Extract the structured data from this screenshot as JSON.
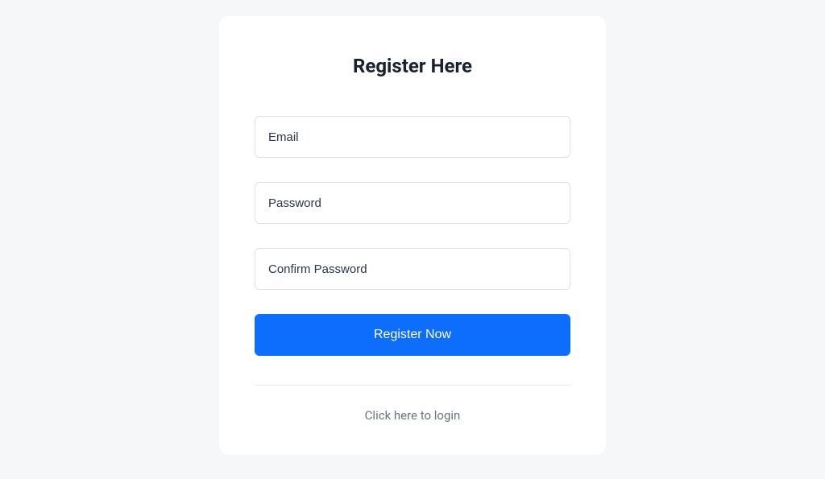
{
  "form": {
    "title": "Register Here",
    "fields": {
      "email": {
        "placeholder": "Email",
        "value": ""
      },
      "password": {
        "placeholder": "Password",
        "value": ""
      },
      "confirm_password": {
        "placeholder": "Confirm Password",
        "value": ""
      }
    },
    "submit_label": "Register Now",
    "login_link_text": "Click here to login"
  }
}
